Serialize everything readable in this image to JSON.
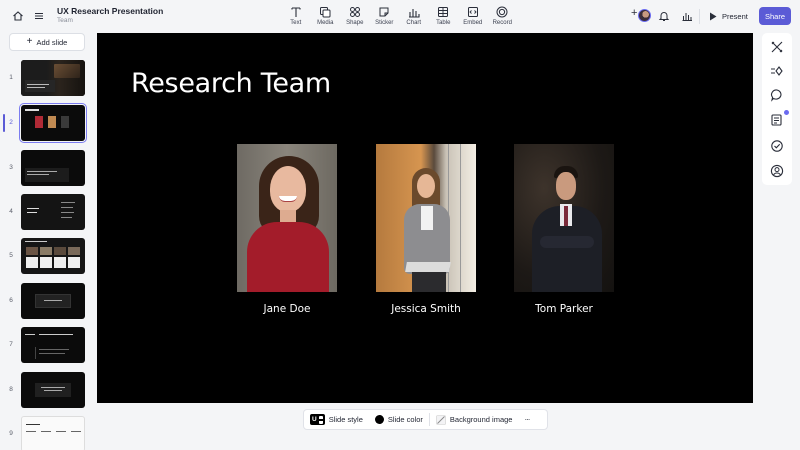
{
  "header": {
    "title": "UX Research Presentation",
    "subtitle": "Team",
    "tools": [
      {
        "label": "Text",
        "icon": "text-icon"
      },
      {
        "label": "Media",
        "icon": "media-icon"
      },
      {
        "label": "Shape",
        "icon": "shape-icon"
      },
      {
        "label": "Sticker",
        "icon": "sticker-icon"
      },
      {
        "label": "Chart",
        "icon": "chart-icon"
      },
      {
        "label": "Table",
        "icon": "table-icon"
      },
      {
        "label": "Embed",
        "icon": "embed-icon"
      },
      {
        "label": "Record",
        "icon": "record-icon"
      }
    ],
    "present_label": "Present",
    "share_label": "Share",
    "add_collaborator_glyph": "+"
  },
  "sidebar": {
    "add_slide_label": "Add slide",
    "slides": [
      {
        "number": "1"
      },
      {
        "number": "2",
        "active": true
      },
      {
        "number": "3"
      },
      {
        "number": "4"
      },
      {
        "number": "5"
      },
      {
        "number": "6"
      },
      {
        "number": "7"
      },
      {
        "number": "8"
      },
      {
        "number": "9"
      }
    ]
  },
  "slide": {
    "title": "Research Team",
    "members": [
      {
        "name": "Jane Doe"
      },
      {
        "name": "Jessica Smith"
      },
      {
        "name": "Tom Parker"
      }
    ]
  },
  "bottom_bar": {
    "slide_style_label": "Slide style",
    "slide_style_badge": "U",
    "slide_color_label": "Slide color",
    "background_image_label": "Background image",
    "more_glyph": "···"
  },
  "colors": {
    "accent": "#5b5bd6",
    "canvas": "#000000",
    "app_bg": "#f4f5f7"
  }
}
